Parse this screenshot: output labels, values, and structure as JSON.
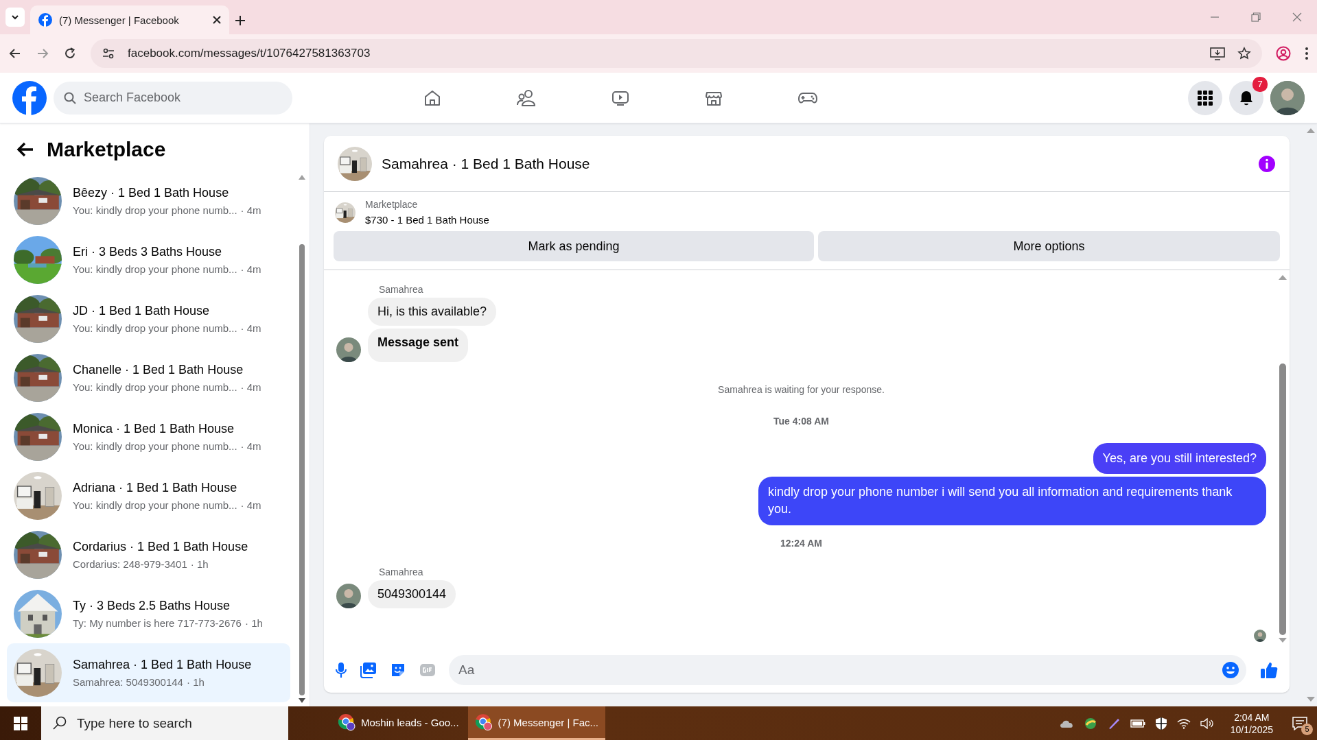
{
  "browser": {
    "tab": {
      "title": "(7) Messenger | Facebook"
    },
    "url": "facebook.com/messages/t/1076427581363703"
  },
  "header": {
    "search": {
      "placeholder": "Search Facebook"
    },
    "notifications_badge": "7"
  },
  "sidebar": {
    "title": "Marketplace",
    "conversations": [
      {
        "title": "Bêezy · 1 Bed 1 Bath House",
        "preview": "You: kindly drop your phone numb...",
        "time": "· 4m",
        "selected": false
      },
      {
        "title": "Eri · 3 Beds 3 Baths House",
        "preview": "You: kindly drop your phone numb...",
        "time": "· 4m",
        "selected": false
      },
      {
        "title": "JD · 1 Bed 1 Bath House",
        "preview": "You: kindly drop your phone numb...",
        "time": "· 4m",
        "selected": false
      },
      {
        "title": "Chanelle · 1 Bed 1 Bath House",
        "preview": "You: kindly drop your phone numb...",
        "time": "· 4m",
        "selected": false
      },
      {
        "title": "Monica · 1 Bed 1 Bath House",
        "preview": "You: kindly drop your phone numb...",
        "time": "· 4m",
        "selected": false
      },
      {
        "title": "Adriana · 1 Bed 1 Bath House",
        "preview": "You: kindly drop your phone numb...",
        "time": "· 4m",
        "selected": false
      },
      {
        "title": "Cordarius · 1 Bed 1 Bath House",
        "preview": "Cordarius: 248-979-3401",
        "time": "· 1h",
        "selected": false
      },
      {
        "title": "Ty · 3 Beds 2.5 Baths House",
        "preview": "Ty: My number is here 717-773-2676",
        "time": "· 1h",
        "selected": false
      },
      {
        "title": "Samahrea · 1 Bed 1 Bath House",
        "preview": "Samahrea: 5049300144",
        "time": "· 1h",
        "selected": true
      }
    ]
  },
  "chat": {
    "title": "Samahrea · 1 Bed 1 Bath House",
    "listing": {
      "label": "Marketplace",
      "summary": "$730 - 1 Bed 1 Bath House"
    },
    "actions": [
      "Mark as pending",
      "More options"
    ],
    "messages": [
      {
        "kind": "sender",
        "text": "Samahrea"
      },
      {
        "kind": "incoming",
        "text": "Hi, is this available?",
        "bold": false,
        "avatar": false
      },
      {
        "kind": "incoming",
        "text": "Message sent",
        "bold": true,
        "avatar": true
      },
      {
        "kind": "notice",
        "text": "Samahrea is waiting for your response."
      },
      {
        "kind": "time",
        "text": "Tue 4:08 AM"
      },
      {
        "kind": "outgoing",
        "text": "Yes, are you still interested?"
      },
      {
        "kind": "outgoing",
        "text": "kindly drop your phone number i will send you all information and requirements thank you."
      },
      {
        "kind": "time",
        "text": "12:24 AM"
      },
      {
        "kind": "sender",
        "text": "Samahrea"
      },
      {
        "kind": "incoming",
        "text": "5049300144",
        "bold": false,
        "avatar": true
      },
      {
        "kind": "seen"
      }
    ],
    "composer": {
      "placeholder": "Aa"
    }
  },
  "taskbar": {
    "search": {
      "placeholder": "Type here to search"
    },
    "apps": [
      {
        "label": "Moshin leads - Goo...",
        "selected": false
      },
      {
        "label": "(7) Messenger | Fac...",
        "selected": true
      }
    ],
    "clock": {
      "time": "2:04 AM",
      "date": "10/1/2025"
    },
    "notifications": "5"
  }
}
